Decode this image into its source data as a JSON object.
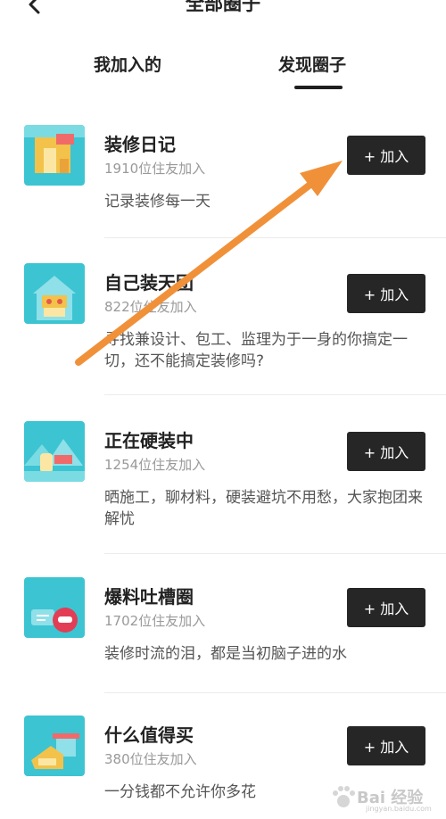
{
  "header": {
    "title": "全部圈子",
    "back_icon": "chevron-left-icon"
  },
  "tabs": [
    {
      "label": "我加入的",
      "active": false
    },
    {
      "label": "发现圈子",
      "active": true
    }
  ],
  "groups": [
    {
      "name": "装修日记",
      "members": "1910位住友加入",
      "description": "记录装修每一天",
      "button": "+ 加入"
    },
    {
      "name": "自己装天团",
      "members": "822位住友加入",
      "description": "寻找兼设计、包工、监理为于一身的你搞定一切，还不能搞定装修吗?",
      "button": "+ 加入"
    },
    {
      "name": "正在硬装中",
      "members": "1254位住友加入",
      "description": "晒施工，聊材料，硬装避坑不用愁，大家抱团来解忧",
      "button": "+ 加入"
    },
    {
      "name": "爆料吐槽圈",
      "members": "1702位住友加入",
      "description": "装修时流的泪，都是当初脑子进的水",
      "button": "+ 加入"
    },
    {
      "name": "什么值得买",
      "members": "380位住友加入",
      "description": "一分钱都不允许你多花",
      "button": "+ 加入"
    }
  ],
  "colors": {
    "button_bg": "#262626",
    "thumb_bg": "#3cc4d2",
    "arrow": "#f0913a"
  },
  "watermark": {
    "text": "Bai 经验",
    "sub": "jingyan.baidu.com"
  }
}
